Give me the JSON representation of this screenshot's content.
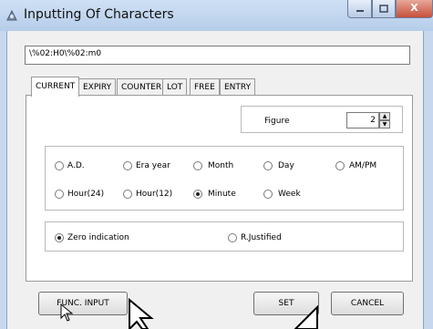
{
  "window": {
    "title": "Inputting Of Characters",
    "close_glyph": "X"
  },
  "formula": {
    "value": "\\%02:H0\\%02:m0"
  },
  "tabs": [
    {
      "label": "CURRENT",
      "active": true
    },
    {
      "label": "EXPIRY",
      "active": false
    },
    {
      "label": "COUNTER",
      "active": false
    },
    {
      "label": "LOT",
      "active": false
    },
    {
      "label": "FREE",
      "active": false
    },
    {
      "label": "ENTRY",
      "active": false
    }
  ],
  "figure": {
    "label": "Figure",
    "value": "2"
  },
  "units": [
    {
      "label": "A.D.",
      "checked": false
    },
    {
      "label": "Era year",
      "checked": false
    },
    {
      "label": "Month",
      "checked": false
    },
    {
      "label": "Day",
      "checked": false
    },
    {
      "label": "AM/PM",
      "checked": false
    },
    {
      "label": "Hour(24)",
      "checked": false
    },
    {
      "label": "Hour(12)",
      "checked": false
    },
    {
      "label": "Minute",
      "checked": true
    },
    {
      "label": "Week",
      "checked": false
    }
  ],
  "format": [
    {
      "label": "Zero indication",
      "checked": true
    },
    {
      "label": "R.Justified",
      "checked": false
    }
  ],
  "buttons": {
    "func_input": "FUNC. INPUT",
    "set": "SET",
    "cancel": "CANCEL"
  }
}
